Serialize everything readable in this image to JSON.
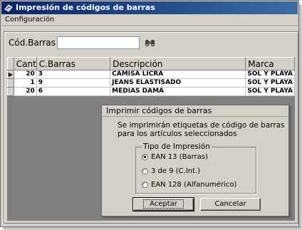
{
  "window": {
    "title": "Impresión de códigos de barras"
  },
  "menu": {
    "items": [
      "Configuración"
    ]
  },
  "barcode": {
    "label": "Cód.Barras",
    "value": "",
    "placeholder": ""
  },
  "grid": {
    "headers": {
      "cant": "Cant",
      "cbarras": "C.Barras",
      "descripcion": "Descripción",
      "marca": "Marca"
    },
    "rows": [
      {
        "cant": "20",
        "cbarras": "3",
        "descripcion": "CAMISA LICRA",
        "marca": "SOL Y PLAYA",
        "selected": true
      },
      {
        "cant": "1",
        "cbarras": "9",
        "descripcion": "JEANS ELASTISADO",
        "marca": "SOL Y PLAYA",
        "selected": false
      },
      {
        "cant": "20",
        "cbarras": "6",
        "descripcion": "MEDIAS DAMA",
        "marca": "SOL Y PLAYA",
        "selected": false
      }
    ]
  },
  "dialog": {
    "title": "Imprimir códigos de barras",
    "message": "Se imprimirán etiquetas de código de barras para los artículos seleccionados",
    "group_label": "Tipo de Impresión",
    "options": [
      {
        "label": "EAN 13 (Barras)",
        "checked": true
      },
      {
        "label": "3 de 9 (C.Int.)",
        "checked": false
      },
      {
        "label": "EAN 128 (Alfanumérico)",
        "checked": false
      }
    ],
    "accept_label": "Aceptar",
    "cancel_label": "Cancelar"
  },
  "colors": {
    "titlebar_start": "#0a246a",
    "titlebar_end": "#3a6ea5",
    "face": "#d4d0c8"
  }
}
